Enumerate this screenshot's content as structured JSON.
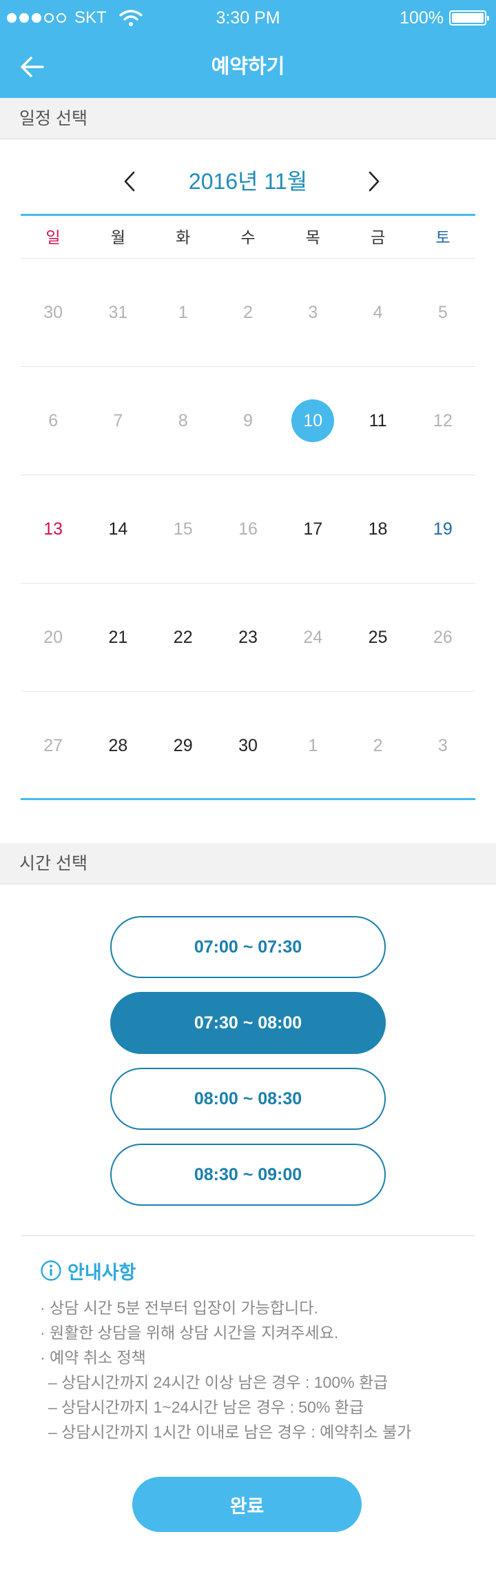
{
  "status_bar": {
    "carrier": "SKT",
    "time": "3:30 PM",
    "battery": "100%"
  },
  "nav": {
    "title": "예약하기",
    "back_icon": "arrow-left-icon"
  },
  "date_section": {
    "header": "일정 선택",
    "month_label": "2016년 11월",
    "weekdays": [
      "일",
      "월",
      "화",
      "수",
      "목",
      "금",
      "토"
    ],
    "weeks": [
      [
        "30",
        "31",
        "1",
        "2",
        "3",
        "4",
        "5"
      ],
      [
        "6",
        "7",
        "8",
        "9",
        "10",
        "11",
        "12"
      ],
      [
        "13",
        "14",
        "15",
        "16",
        "17",
        "18",
        "19"
      ],
      [
        "20",
        "21",
        "22",
        "23",
        "24",
        "25",
        "26"
      ],
      [
        "27",
        "28",
        "29",
        "30",
        "1",
        "2",
        "3"
      ]
    ],
    "selected_date": "10"
  },
  "time_section": {
    "header": "시간 선택",
    "slots": [
      "07:00 ~ 07:30",
      "07:30 ~ 08:00",
      "08:00 ~ 08:30",
      "08:30 ~ 09:00"
    ],
    "selected_slot": "07:30 ~ 08:00"
  },
  "notice": {
    "title": "안내사항",
    "items": [
      "· 상담 시간 5분 전부터 입장이 가능합니다.",
      "· 원활한 상담을 위해 상담 시간을 지켜주세요.",
      "· 예약 취소 정책",
      "– 상담시간까지 24시간 이상 남은 경우 : 100% 환급",
      "– 상담시간까지 1~24시간 남은 경우 : 50% 환급",
      "– 상담시간까지 1시간 이내로 남은 경우 : 예약취소 불가"
    ]
  },
  "done_label": "완료",
  "colors": {
    "primary": "#47b9ec",
    "selected_slot": "#1f84b2",
    "sunday": "#d0114f",
    "saturday": "#2069a6"
  }
}
